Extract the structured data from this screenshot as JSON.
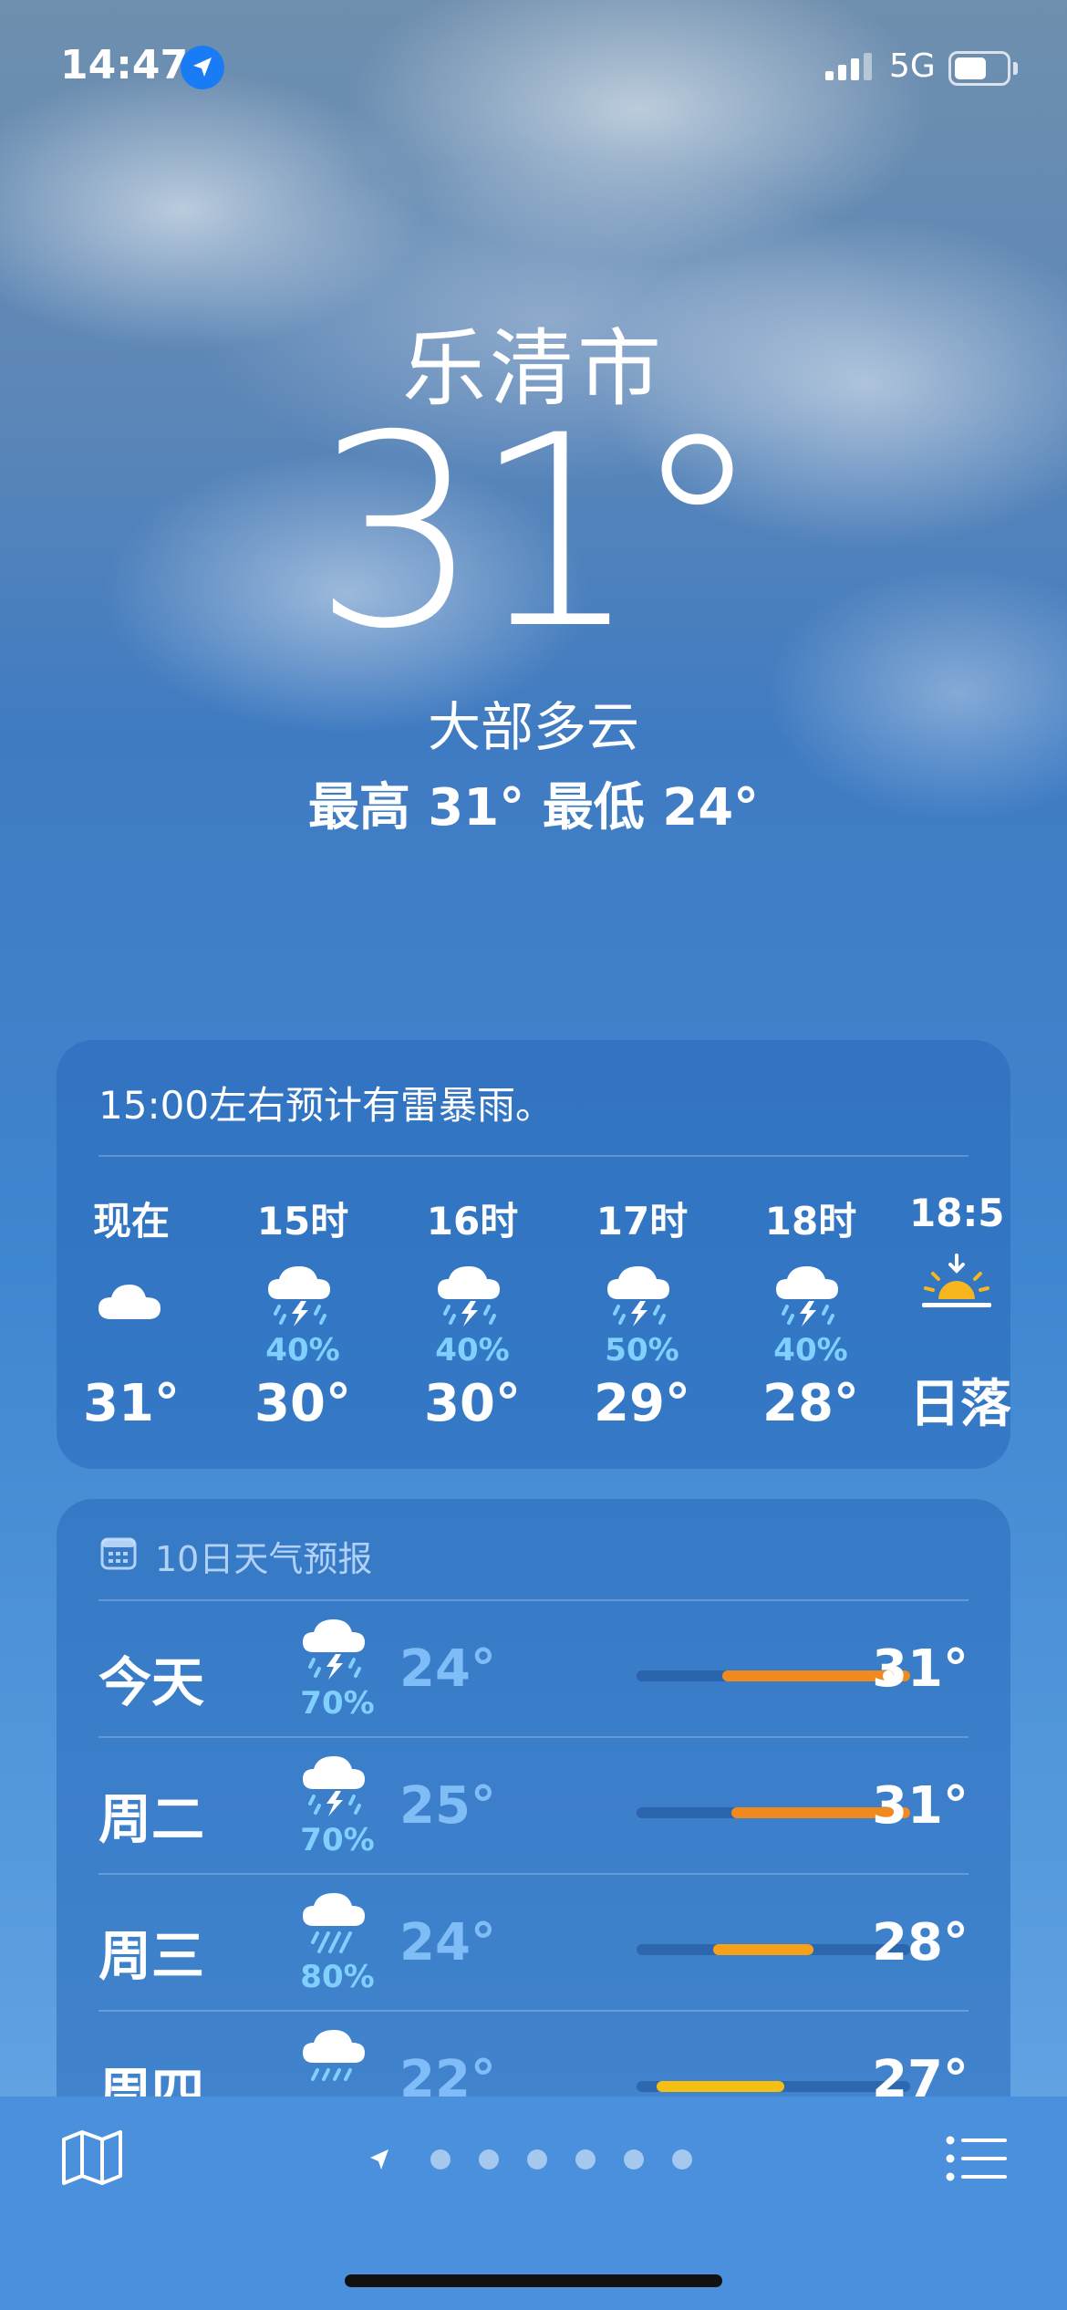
{
  "status_bar": {
    "time": "14:47",
    "network": "5G"
  },
  "location": {
    "city": "乐清市",
    "temperature": "31°",
    "condition": "大部多云",
    "high_low": "最高 31°  最低 24°"
  },
  "hourly": {
    "summary": "15:00左右预计有雷暴雨。",
    "items": [
      {
        "label": "现在",
        "icon": "cloud-icon",
        "precip": "",
        "temp": "31°"
      },
      {
        "label": "15时",
        "icon": "thunderstorm-icon",
        "precip": "40%",
        "temp": "30°"
      },
      {
        "label": "16时",
        "icon": "thunderstorm-icon",
        "precip": "40%",
        "temp": "30°"
      },
      {
        "label": "17时",
        "icon": "thunderstorm-icon",
        "precip": "50%",
        "temp": "29°"
      },
      {
        "label": "18时",
        "icon": "thunderstorm-icon",
        "precip": "40%",
        "temp": "28°"
      },
      {
        "label": "18:5",
        "icon": "sunset-icon",
        "precip": "",
        "temp": "日落"
      }
    ]
  },
  "forecast": {
    "title": "10日天气预报",
    "days": [
      {
        "day": "今天",
        "icon": "thunderstorm-icon",
        "precip": "70%",
        "low": "24°",
        "high": "31°"
      },
      {
        "day": "周二",
        "icon": "thunderstorm-icon",
        "precip": "70%",
        "low": "25°",
        "high": "31°"
      },
      {
        "day": "周三",
        "icon": "rain-icon",
        "precip": "80%",
        "low": "24°",
        "high": "28°"
      },
      {
        "day": "周四",
        "icon": "rain-icon",
        "precip": "",
        "low": "22°",
        "high": "27°"
      }
    ]
  },
  "colors": {
    "accent_orange": "#f08a1f",
    "accent_amber": "#f7a11b",
    "accent_yellow": "#f5c013",
    "precip_blue": "#7fd0ff"
  }
}
